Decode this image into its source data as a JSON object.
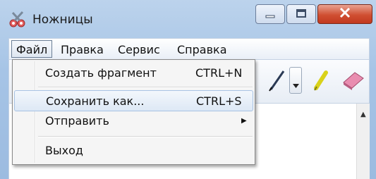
{
  "window": {
    "title": "Ножницы"
  },
  "menubar": {
    "items": [
      {
        "label": "Файл"
      },
      {
        "label": "Правка"
      },
      {
        "label": "Сервис"
      },
      {
        "label": "Справка"
      }
    ]
  },
  "file_menu": {
    "items": [
      {
        "label": "Создать фрагмент",
        "shortcut": "CTRL+N"
      },
      {
        "label": "Сохранить как...",
        "shortcut": "CTRL+S"
      },
      {
        "label": "Отправить",
        "submenu": true
      },
      {
        "label": "Выход"
      }
    ]
  },
  "colors": {
    "accent": "#a8c3e4",
    "close": "#d04f32"
  },
  "icons": [
    "scissors-icon",
    "minimize-icon",
    "maximize-icon",
    "close-icon",
    "pen-icon",
    "dropdown-arrow-icon",
    "highlighter-icon",
    "eraser-icon",
    "scroll-up-icon",
    "submenu-arrow-icon"
  ]
}
